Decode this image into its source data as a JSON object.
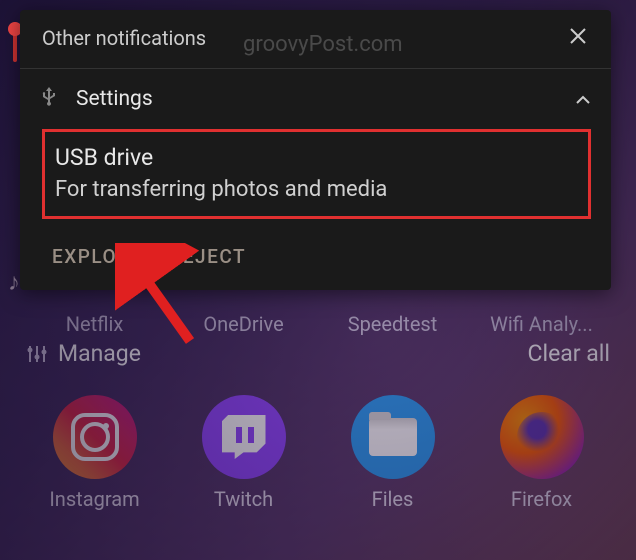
{
  "watermark": "groovyPost.com",
  "panel": {
    "header_title": "Other notifications",
    "settings_label": "Settings",
    "notification": {
      "title": "USB drive",
      "subtitle": "For transferring photos and media"
    },
    "actions": {
      "explore": "EXPLORE",
      "eject": "EJECT"
    }
  },
  "controls": {
    "manage": "Manage",
    "clear_all": "Clear all"
  },
  "apps_row1": [
    {
      "label": "Netflix"
    },
    {
      "label": "OneDrive"
    },
    {
      "label": "Speedtest"
    },
    {
      "label": "Wifi Analy..."
    }
  ],
  "apps_row2": [
    {
      "label": "Instagram"
    },
    {
      "label": "Twitch"
    },
    {
      "label": "Files"
    },
    {
      "label": "Firefox"
    }
  ]
}
